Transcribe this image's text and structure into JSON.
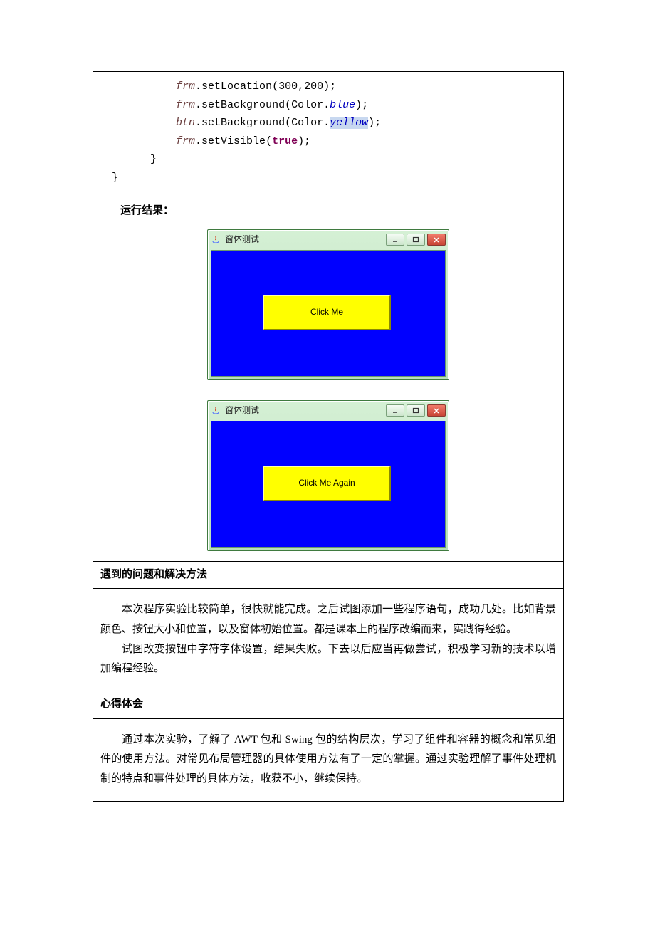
{
  "code": {
    "indent1": "            ",
    "indent2": "        }",
    "indent3": "  }",
    "frm": "frm",
    "btn": "btn",
    "m_setLocation": ".setLocation(300,200);",
    "m_setBackground_pre": ".setBackground(Color.",
    "m_setBackground_post": ");",
    "blue": "blue",
    "yellow": "yellow",
    "m_setVisible_pre": ".setVisible(",
    "m_setVisible_post": ");",
    "true": "true"
  },
  "labels": {
    "run_result": "运行结果：",
    "problems_heading": "遇到的问题和解决方法",
    "experience_heading": "心得体会"
  },
  "window": {
    "title": "窗体测试",
    "btn1": "Click Me",
    "btn2": "Click Me Again"
  },
  "problems": {
    "p1": "本次程序实验比较简单，很快就能完成。之后试图添加一些程序语句，成功几处。比如背景颜色、按钮大小和位置，以及窗体初始位置。都是课本上的程序改编而来，实践得经验。",
    "p2": "试图改变按钮中字符字体设置，结果失败。下去以后应当再做尝试，积极学习新的技术以增加编程经验。"
  },
  "experience": {
    "p1": "通过本次实验，了解了 AWT 包和 Swing 包的结构层次，学习了组件和容器的概念和常见组件的使用方法。对常见布局管理器的具体使用方法有了一定的掌握。通过实验理解了事件处理机制的特点和事件处理的具体方法，收获不小，继续保持。"
  }
}
